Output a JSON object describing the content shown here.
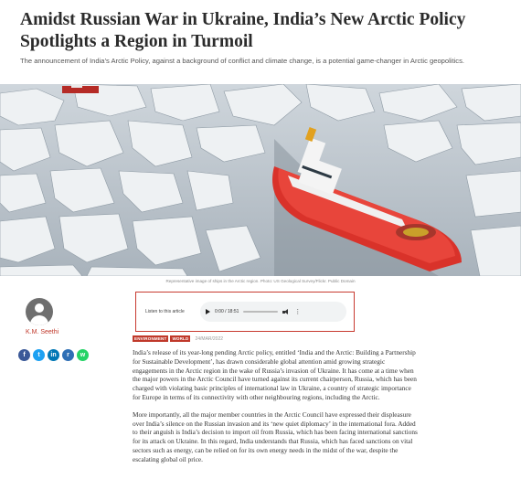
{
  "article": {
    "title": "Amidst Russian War in Ukraine, India’s New Arctic Policy Spotlights a Region in Turmoil",
    "standfirst": "The announcement of India’s Arctic Policy, against a background of conflict and climate change, is a potential game-changer in Arctic geopolitics.",
    "image_caption": "Representative image of ships in the Arctic region. Photo: US Geological Survey/Flickr. Public Domain",
    "author": "K.M. Seethi",
    "tags": [
      "ENVIRONMENT",
      "WORLD"
    ],
    "date": "24/MAR/2022",
    "paragraphs": [
      "India’s release of its year-long pending Arctic policy, entitled ‘India and the Arctic: Building a Partnership for Sustainable Development’, has drawn considerable global attention amid growing strategic engagements in the Arctic region in the wake of Russia’s invasion of Ukraine. It has come at a time when the major powers in the Arctic Council have turned against its current chairperson, Russia, which has been charged with violating basic principles of international law in Ukraine, a country of strategic importance for Europe in terms of its connectivity with other neighbouring regions, including the Arctic.",
      "More importantly, all the major member countries in the Arctic Council have expressed their displeasure over India’s silence on the Russian invasion and its ‘new quiet diplomacy’ in the international fora. Added to their anguish is India’s decision to import oil from Russia, which has been facing international sanctions for its attack on Ukraine. In this regard, India understands that Russia, which has faced sanctions on vital sectors such as energy, can be relied on for its own energy needs in the midst of the war, despite the escalating global oil price."
    ]
  },
  "audio": {
    "label": "Listen to this article",
    "time": "0:00 / 18:51",
    "progress": 0
  },
  "share": {
    "icons": [
      "facebook-icon",
      "twitter-icon",
      "linkedin-icon",
      "reddit-icon",
      "whatsapp-icon"
    ],
    "colors": [
      "#3b5998",
      "#1da1f2",
      "#0077b5",
      "#2f6fb5",
      "#25d366"
    ]
  }
}
